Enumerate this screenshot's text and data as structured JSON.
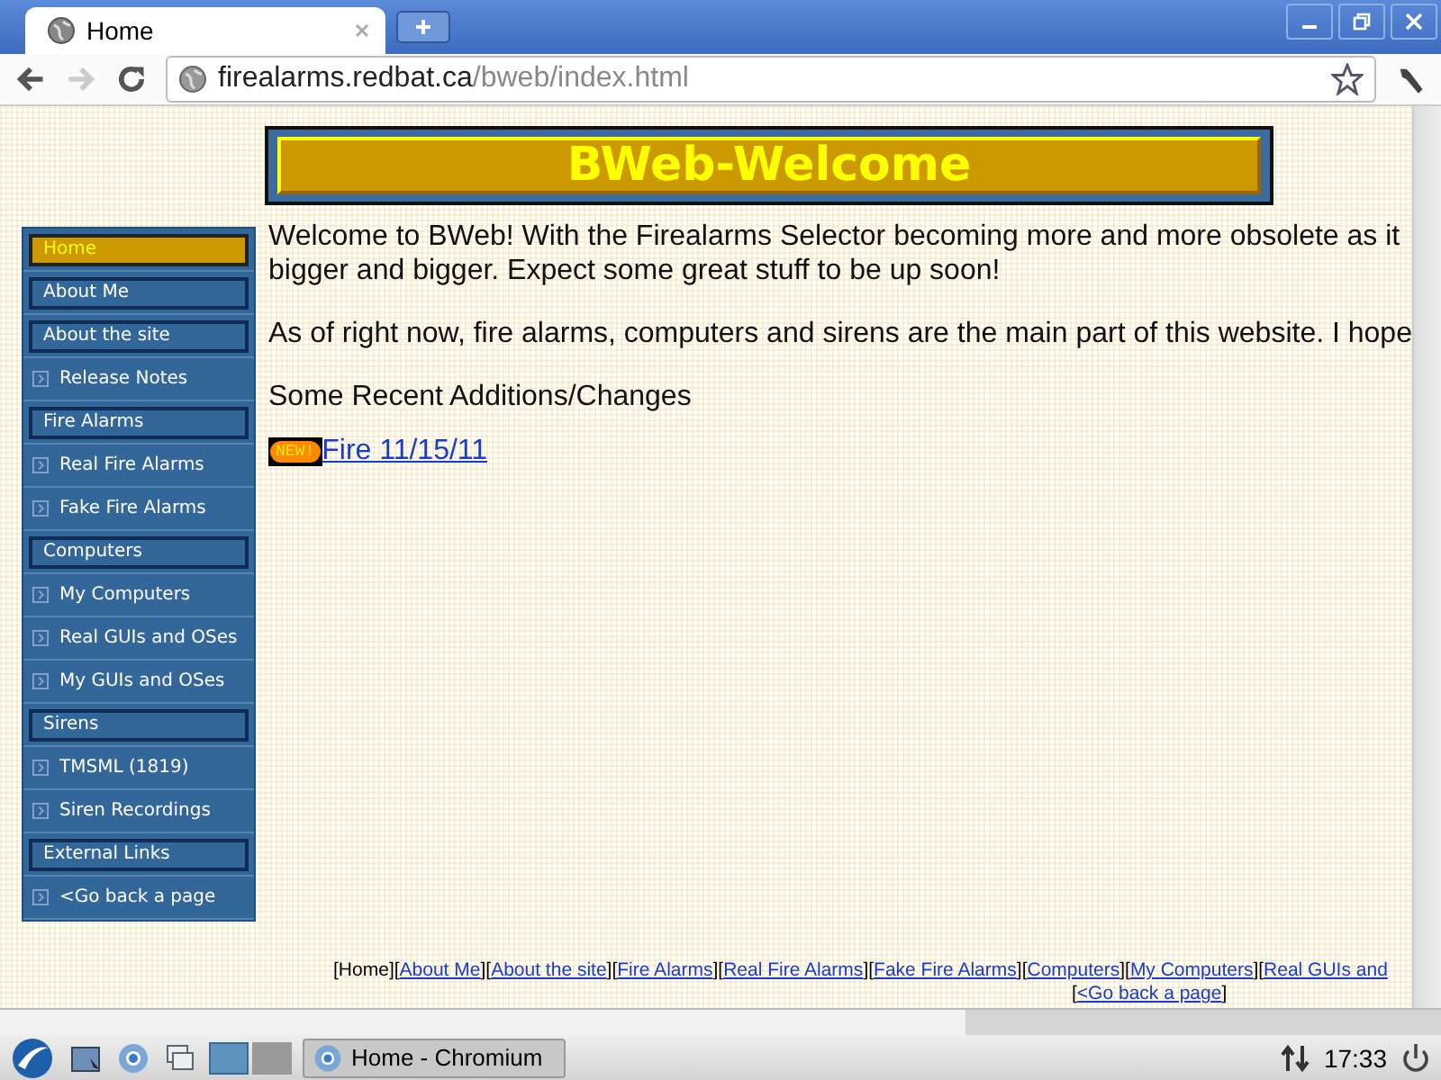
{
  "browser": {
    "tab": {
      "title": "Home"
    },
    "url": {
      "host": "firealarms.redbat.ca",
      "path": "/bweb/index.html"
    }
  },
  "page": {
    "banner": "BWeb-Welcome",
    "sidebar": [
      {
        "label": "Home",
        "kind": "heading",
        "selected": true
      },
      {
        "label": "About Me",
        "kind": "heading",
        "selected": false
      },
      {
        "label": "About the site",
        "kind": "heading",
        "selected": false
      },
      {
        "label": "Release Notes",
        "kind": "link",
        "selected": false
      },
      {
        "label": "Fire Alarms",
        "kind": "heading",
        "selected": false
      },
      {
        "label": "Real Fire Alarms",
        "kind": "link",
        "selected": false
      },
      {
        "label": "Fake Fire Alarms",
        "kind": "link",
        "selected": false
      },
      {
        "label": "Computers",
        "kind": "heading",
        "selected": false
      },
      {
        "label": "My Computers",
        "kind": "link",
        "selected": false
      },
      {
        "label": "Real GUIs and OSes",
        "kind": "link",
        "selected": false
      },
      {
        "label": "My GUIs and OSes",
        "kind": "link",
        "selected": false
      },
      {
        "label": "Sirens",
        "kind": "heading",
        "selected": false
      },
      {
        "label": "TMSML (1819)",
        "kind": "link",
        "selected": false
      },
      {
        "label": "Siren Recordings",
        "kind": "link",
        "selected": false
      },
      {
        "label": "External Links",
        "kind": "heading",
        "selected": false
      },
      {
        "label": "<Go back a page",
        "kind": "link",
        "selected": false
      }
    ],
    "paragraphs": [
      "Welcome to BWeb! With the Firealarms Selector becoming more and more obsolete as it\nbigger and bigger. Expect some great stuff to be up soon!",
      "As of right now, fire alarms, computers and sirens are the main part of this website. I hope"
    ],
    "recent_heading": "Some Recent Additions/Changes",
    "recent": [
      {
        "badge": "NEW!",
        "link": "Fire 11/15/11"
      }
    ],
    "footer_links": [
      {
        "open": "[",
        "label": "Home",
        "close": "]",
        "selected": true
      },
      {
        "open": "[",
        "label": "About Me",
        "close": "]",
        "selected": false
      },
      {
        "open": "[",
        "label": "About the site",
        "close": "]",
        "selected": false
      },
      {
        "open": "[",
        "label": "Fire Alarms",
        "close": "]",
        "selected": false
      },
      {
        "open": "[",
        "label": "Real Fire Alarms",
        "close": "]",
        "selected": false
      },
      {
        "open": "[",
        "label": "Fake Fire Alarms",
        "close": "]",
        "selected": false
      },
      {
        "open": "[",
        "label": "Computers",
        "close": "]",
        "selected": false
      },
      {
        "open": "[",
        "label": "My Computers",
        "close": "]",
        "selected": false
      },
      {
        "open": "[",
        "label": "Real GUIs and",
        "selected": false
      }
    ],
    "footer_links_2": [
      {
        "open": "[",
        "label": "<Go back a page",
        "close": "]",
        "selected": false
      }
    ]
  },
  "taskbar": {
    "workspaces": [
      {
        "selected": true
      },
      {
        "selected": false
      }
    ],
    "task": "Home - Chromium",
    "clock": "17:33"
  }
}
